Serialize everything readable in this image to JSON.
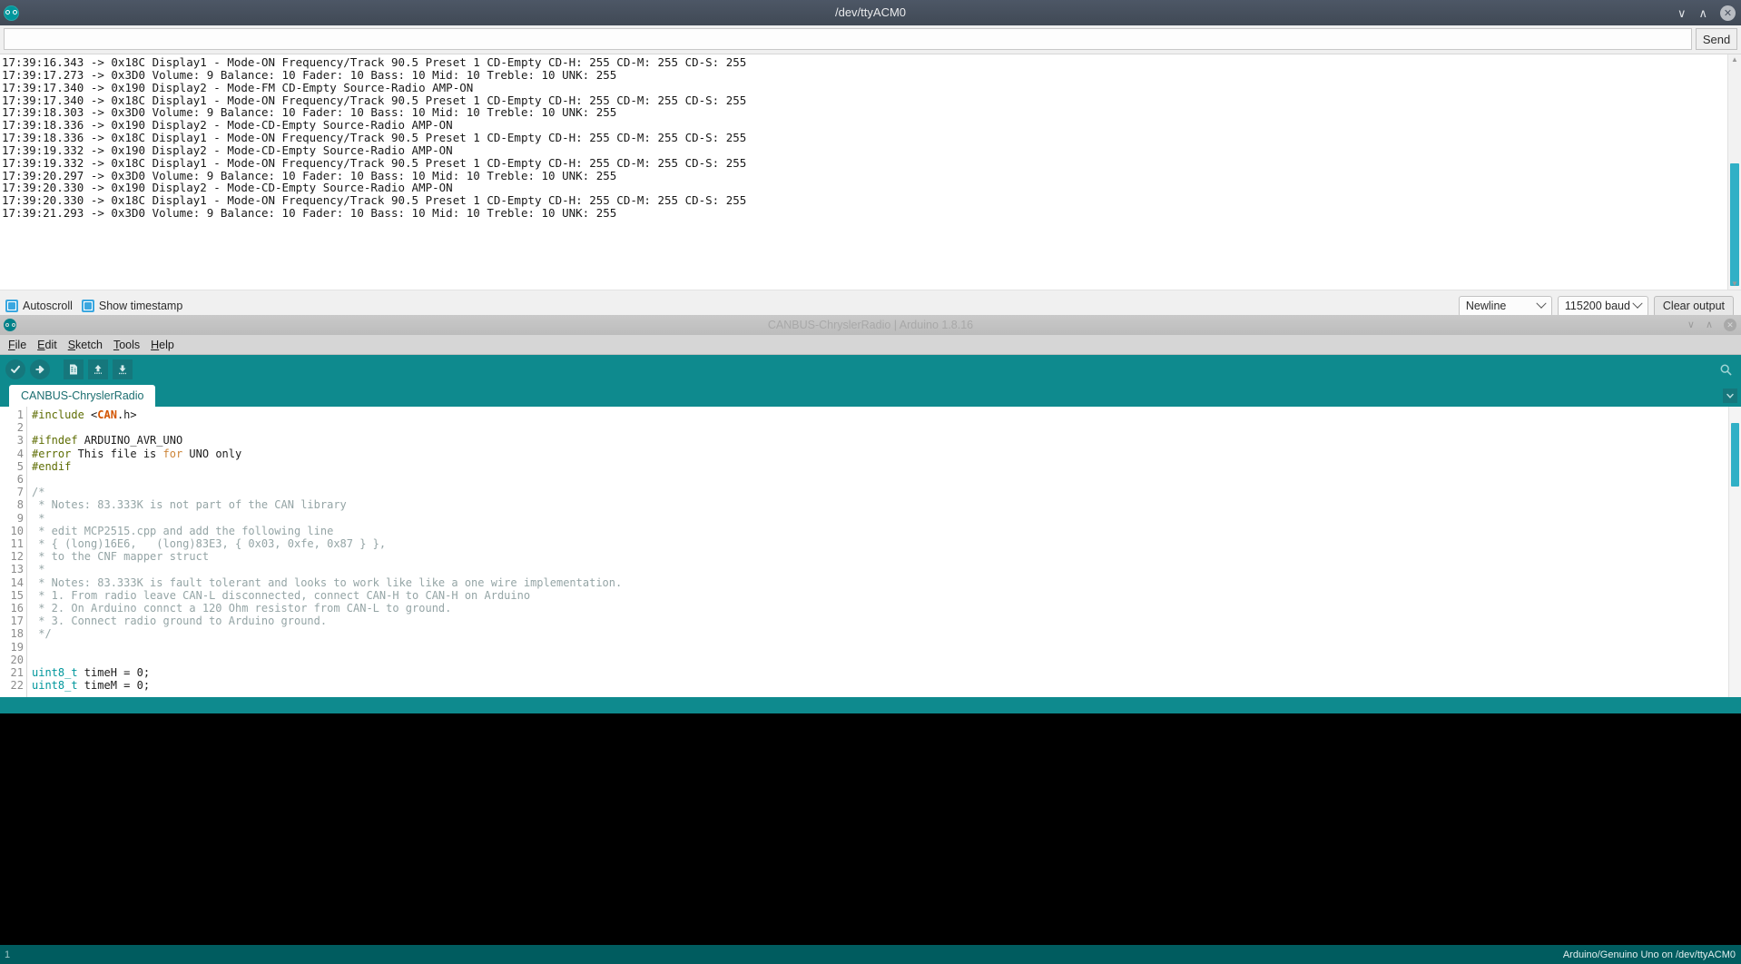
{
  "serial_monitor": {
    "title": "/dev/ttyACM0",
    "window_controls": {
      "minimize": "∨",
      "maximize": "∧",
      "close": "✕"
    },
    "input": {
      "value": "",
      "placeholder": ""
    },
    "send_button": "Send",
    "output_lines": [
      "17:39:16.343 -> 0x18C Display1 - Mode-ON Frequency/Track 90.5 Preset 1 CD-Empty CD-H: 255 CD-M: 255 CD-S: 255",
      "17:39:17.273 -> 0x3D0 Volume: 9 Balance: 10 Fader: 10 Bass: 10 Mid: 10 Treble: 10 UNK: 255",
      "17:39:17.340 -> 0x190 Display2 - Mode-FM CD-Empty Source-Radio AMP-ON",
      "17:39:17.340 -> 0x18C Display1 - Mode-ON Frequency/Track 90.5 Preset 1 CD-Empty CD-H: 255 CD-M: 255 CD-S: 255",
      "17:39:18.303 -> 0x3D0 Volume: 9 Balance: 10 Fader: 10 Bass: 10 Mid: 10 Treble: 10 UNK: 255",
      "17:39:18.336 -> 0x190 Display2 - Mode-CD-Empty Source-Radio AMP-ON",
      "17:39:18.336 -> 0x18C Display1 - Mode-ON Frequency/Track 90.5 Preset 1 CD-Empty CD-H: 255 CD-M: 255 CD-S: 255",
      "17:39:19.332 -> 0x190 Display2 - Mode-CD-Empty Source-Radio AMP-ON",
      "17:39:19.332 -> 0x18C Display1 - Mode-ON Frequency/Track 90.5 Preset 1 CD-Empty CD-H: 255 CD-M: 255 CD-S: 255",
      "17:39:20.297 -> 0x3D0 Volume: 9 Balance: 10 Fader: 10 Bass: 10 Mid: 10 Treble: 10 UNK: 255",
      "17:39:20.330 -> 0x190 Display2 - Mode-CD-Empty Source-Radio AMP-ON",
      "17:39:20.330 -> 0x18C Display1 - Mode-ON Frequency/Track 90.5 Preset 1 CD-Empty CD-H: 255 CD-M: 255 CD-S: 255",
      "17:39:21.293 -> 0x3D0 Volume: 9 Balance: 10 Fader: 10 Bass: 10 Mid: 10 Treble: 10 UNK: 255"
    ],
    "footer": {
      "autoscroll_label": "Autoscroll",
      "autoscroll_checked": true,
      "show_timestamp_label": "Show timestamp",
      "show_timestamp_checked": true,
      "line_ending_selected": "Newline",
      "baud_selected": "115200 baud",
      "clear_output_label": "Clear output"
    },
    "accent_color": "#31b0c6"
  },
  "ide": {
    "title": "CANBUS-ChryslerRadio | Arduino 1.8.16",
    "window_controls": {
      "minimize": "∨",
      "maximize": "∧",
      "close": "✕"
    },
    "menu": [
      {
        "mnemonic": "F",
        "rest": "ile"
      },
      {
        "mnemonic": "E",
        "rest": "dit"
      },
      {
        "mnemonic": "S",
        "rest": "ketch"
      },
      {
        "mnemonic": "T",
        "rest": "ools"
      },
      {
        "mnemonic": "H",
        "rest": "elp"
      }
    ],
    "toolbar": {
      "verify": "verify-icon",
      "upload": "upload-icon",
      "new": "new-sketch-icon",
      "open": "open-sketch-icon",
      "save": "save-sketch-icon",
      "serial_monitor": "serial-monitor-icon"
    },
    "tab_label": "CANBUS-ChryslerRadio",
    "accent_color": "#0e8a8e",
    "code": [
      {
        "n": "1",
        "tokens": [
          {
            "t": "pre",
            "v": "#include"
          },
          {
            "t": "plain",
            "v": " <"
          },
          {
            "t": "lib",
            "v": "CAN"
          },
          {
            "t": "plain",
            "v": ".h>"
          }
        ]
      },
      {
        "n": "2",
        "tokens": []
      },
      {
        "n": "3",
        "tokens": [
          {
            "t": "pre",
            "v": "#ifndef"
          },
          {
            "t": "plain",
            "v": " ARDUINO_AVR_UNO"
          }
        ]
      },
      {
        "n": "4",
        "tokens": [
          {
            "t": "pre",
            "v": "#error"
          },
          {
            "t": "plain",
            "v": " This file is "
          },
          {
            "t": "kw",
            "v": "for"
          },
          {
            "t": "plain",
            "v": " UNO only"
          }
        ]
      },
      {
        "n": "5",
        "tokens": [
          {
            "t": "pre",
            "v": "#endif"
          }
        ]
      },
      {
        "n": "6",
        "tokens": []
      },
      {
        "n": "7",
        "tokens": [
          {
            "t": "com",
            "v": "/*"
          }
        ]
      },
      {
        "n": "8",
        "tokens": [
          {
            "t": "com",
            "v": " * Notes: 83.333K is not part of the CAN library"
          }
        ]
      },
      {
        "n": "9",
        "tokens": [
          {
            "t": "com",
            "v": " *"
          }
        ]
      },
      {
        "n": "10",
        "tokens": [
          {
            "t": "com",
            "v": " * edit MCP2515.cpp and add the following line"
          }
        ]
      },
      {
        "n": "11",
        "tokens": [
          {
            "t": "com",
            "v": " * { (long)16E6,   (long)83E3, { 0x03, 0xfe, 0x87 } },"
          }
        ]
      },
      {
        "n": "12",
        "tokens": [
          {
            "t": "com",
            "v": " * to the CNF mapper struct"
          }
        ]
      },
      {
        "n": "13",
        "tokens": [
          {
            "t": "com",
            "v": " *"
          }
        ]
      },
      {
        "n": "14",
        "tokens": [
          {
            "t": "com",
            "v": " * Notes: 83.333K is fault tolerant and looks to work like like a one wire implementation."
          }
        ]
      },
      {
        "n": "15",
        "tokens": [
          {
            "t": "com",
            "v": " * 1. From radio leave CAN-L disconnected, connect CAN-H to CAN-H on Arduino"
          }
        ]
      },
      {
        "n": "16",
        "tokens": [
          {
            "t": "com",
            "v": " * 2. On Arduino connct a 120 Ohm resistor from CAN-L to ground."
          }
        ]
      },
      {
        "n": "17",
        "tokens": [
          {
            "t": "com",
            "v": " * 3. Connect radio ground to Arduino ground."
          }
        ]
      },
      {
        "n": "18",
        "tokens": [
          {
            "t": "com",
            "v": " */"
          }
        ]
      },
      {
        "n": "19",
        "tokens": []
      },
      {
        "n": "20",
        "tokens": []
      },
      {
        "n": "21",
        "tokens": [
          {
            "t": "type",
            "v": "uint8_t"
          },
          {
            "t": "plain",
            "v": " timeH = 0;"
          }
        ]
      },
      {
        "n": "22",
        "tokens": [
          {
            "t": "type",
            "v": "uint8_t"
          },
          {
            "t": "plain",
            "v": " timeM = 0;"
          }
        ]
      }
    ],
    "status_bar": {
      "left": "1",
      "right": "Arduino/Genuino Uno on /dev/ttyACM0"
    }
  }
}
